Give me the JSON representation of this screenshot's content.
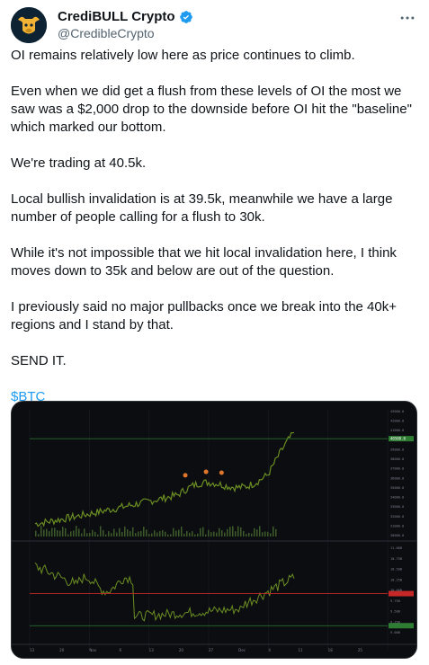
{
  "author": {
    "name": "CrediBULL Crypto",
    "handle": "@CredibleCrypto",
    "avatar_icon": "bull-avatar-icon",
    "verified_icon": "verified-badge-icon",
    "more_icon": "more-options-icon"
  },
  "tweet": {
    "paragraphs": [
      "OI remains relatively low here as price continues to climb.",
      "Even when we did get a flush from these levels of OI the most we saw was a $2,000 drop to the downside before OI hit the \"baseline\" which marked our bottom.",
      "We're trading at 40.5k.",
      "Local bullish invalidation is at 39.5k, meanwhile we have a large number of people calling for a flush to 30k.",
      "While it's not impossible that we hit local invalidation here, I think moves down to 35k and below are out of the question.",
      "I previously said no major pullbacks once we break into the 40k+ regions and I stand by that.",
      "SEND IT."
    ],
    "cashtag": "$BTC"
  },
  "chart_data": {
    "type": "line",
    "price_panel": {
      "ylim": [
        29000,
        44000
      ],
      "ticks": [
        "43000.0",
        "42000.0",
        "41000.0",
        "40000.0",
        "39000.0",
        "38000.0",
        "37000.0",
        "36000.0",
        "35000.0",
        "34000.0",
        "33000.0",
        "32000.0",
        "31000.0",
        "30000.0"
      ],
      "highlight_label": "40500.0",
      "horizontal_level": 40500
    },
    "oi_panel": {
      "ticks": [
        "11.00B",
        "10.75B",
        "10.50B",
        "10.25B",
        "10.00B",
        "9.75B",
        "9.50B",
        "9.25B",
        "9.00B"
      ],
      "levels": [
        9.95,
        9.25
      ]
    },
    "x_ticks": [
      "13",
      "20",
      "Nov",
      "6",
      "13",
      "20",
      "27",
      "Dec",
      "4",
      "11",
      "18",
      "25"
    ],
    "colors": {
      "background": "#0c0d10",
      "up": "#26a69a",
      "down": "#ef5350",
      "price_line": "#6b8e23",
      "level_green": "#2e7d32",
      "level_red": "#c62828",
      "volume": "#3d5a2a"
    }
  }
}
